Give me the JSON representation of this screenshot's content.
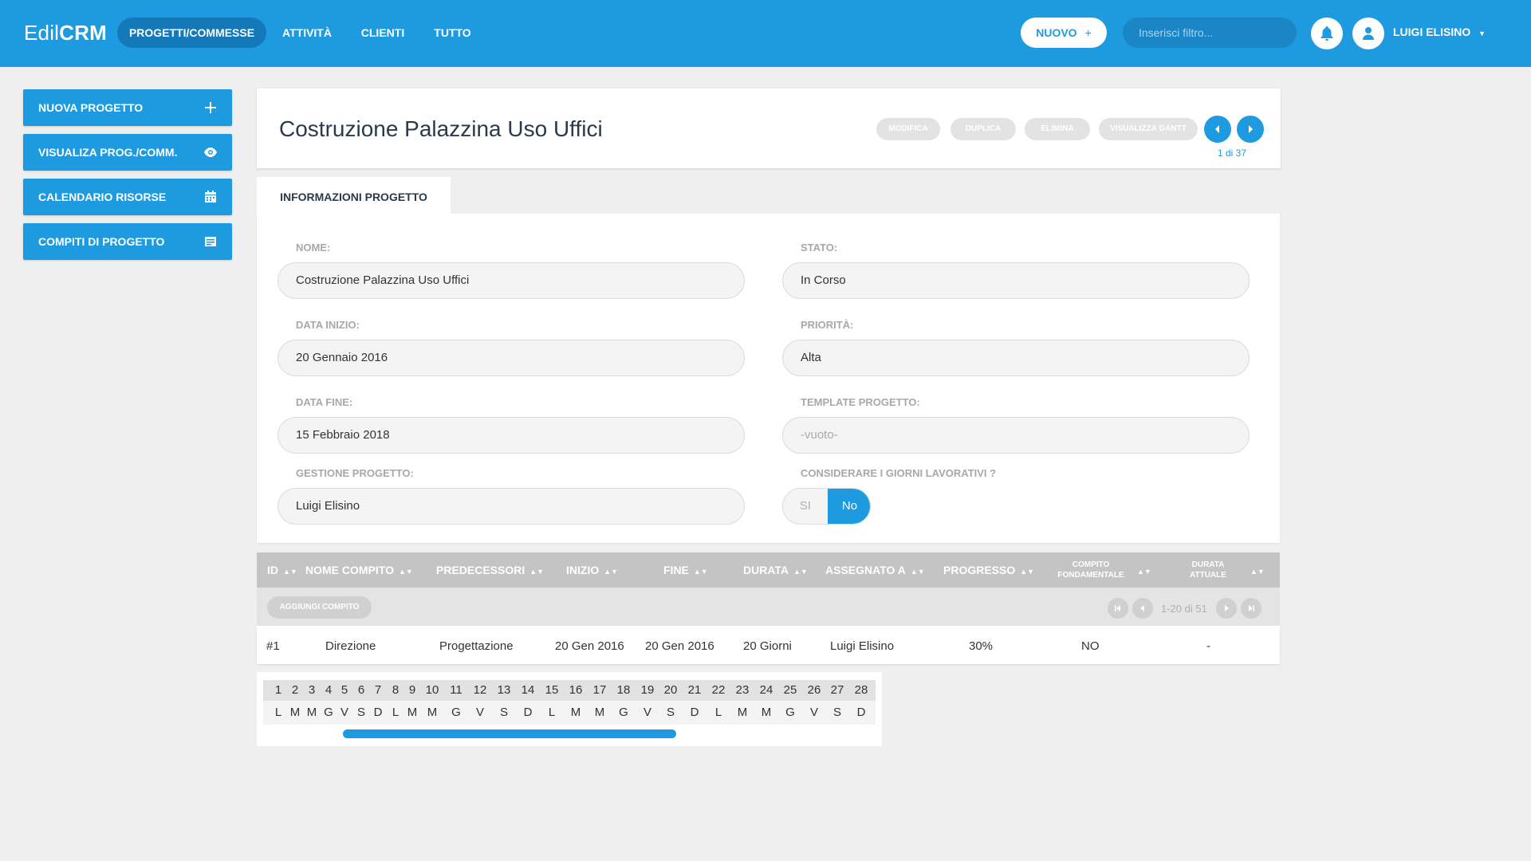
{
  "app": {
    "logo_light": "Edil",
    "logo_bold": "CRM"
  },
  "nav": {
    "items": [
      {
        "label": "PROGETTI/COMMESSE"
      },
      {
        "label": "ATTIVITÀ"
      },
      {
        "label": "CLIENTI"
      },
      {
        "label": "TUTTO"
      }
    ],
    "new_button": "NUOVO",
    "new_plus": "+",
    "filter_placeholder": "Inserisci filtro...",
    "user_name": "LUIGI ELISINO"
  },
  "sidebar": {
    "items": [
      {
        "label": "NUOVA PROGETTO",
        "icon": "plus-icon"
      },
      {
        "label": "VISUALIZA  PROG./COMM.",
        "icon": "eye-icon"
      },
      {
        "label": "CALENDARIO RISORSE",
        "icon": "calendar-icon"
      },
      {
        "label": "COMPITI DI PROGETTO",
        "icon": "list-icon"
      }
    ]
  },
  "header": {
    "title": "Costruzione Palazzina Uso Uffici",
    "actions": [
      "MODIFICA",
      "DUPLICA",
      "ELIMINA",
      "VISUALIZZA GANTT"
    ],
    "pager": "1 di 37"
  },
  "tab": {
    "label": "INFORMAZIONI PROGETTO"
  },
  "form": {
    "nome": {
      "label": "NOME:",
      "value": "Costruzione Palazzina Uso Uffici"
    },
    "stato": {
      "label": "STATO:",
      "value": "In Corso"
    },
    "data_inizio": {
      "label": "DATA INIZIO:",
      "value": "20 Gennaio 2016"
    },
    "priorita": {
      "label": "PRIORITÀ:",
      "value": "Alta"
    },
    "data_fine": {
      "label": "DATA FINE:",
      "value": "15 Febbraio 2018"
    },
    "template": {
      "label": "TEMPLATE PROGETTO:",
      "value": "-vuoto-"
    },
    "gestione": {
      "label": "GESTIONE PROGETTO:",
      "value": "Luigi Elisino"
    },
    "giorni": {
      "label": "CONSIDERARE I GIORNI LAVORATIVI ?",
      "option_si": "SI",
      "option_no": "No",
      "selected": "No"
    }
  },
  "table": {
    "headers": {
      "id": "ID",
      "nome": "NOME COMPITO",
      "predecessori": "PREDECESSORI",
      "inizio": "INIZIO",
      "fine": "FINE",
      "durata": "DURATA",
      "assegnato": "ASSEGNATO A",
      "progresso": "PROGRESSO",
      "fondamentale_1": "COMPITO",
      "fondamentale_2": "FONDAMENTALE",
      "attuale_1": "DURATA",
      "attuale_2": "ATTUALE"
    },
    "add_button": "AGGIUNGI COMPITO",
    "pagination": "1-20 di 51",
    "rows": [
      {
        "id": "#1",
        "nome": "Direzione",
        "predecessori": "Progettazione",
        "inizio": "20 Gen 2016",
        "fine": "20 Gen 2016",
        "durata": "20 Giorni",
        "assegnato": "Luigi Elisino",
        "progresso": "30%",
        "fondamentale": "NO",
        "attuale": "-"
      }
    ]
  },
  "gantt": {
    "days": [
      "1",
      "2",
      "3",
      "4",
      "5",
      "6",
      "7",
      "8",
      "9",
      "10",
      "11",
      "12",
      "13",
      "14",
      "15",
      "16",
      "17",
      "18",
      "19",
      "20",
      "21",
      "22",
      "23",
      "24",
      "25",
      "26",
      "27",
      "28"
    ],
    "weekdays": [
      "L",
      "M",
      "M",
      "G",
      "V",
      "S",
      "D",
      "L",
      "M",
      "M",
      "G",
      "V",
      "S",
      "D",
      "L",
      "M",
      "M",
      "G",
      "V",
      "S",
      "D",
      "L",
      "M",
      "M",
      "G",
      "V",
      "S",
      "D"
    ]
  },
  "colors": {
    "primary": "#1e9be0",
    "primary_dark": "#1578b8",
    "background": "#efefef"
  }
}
